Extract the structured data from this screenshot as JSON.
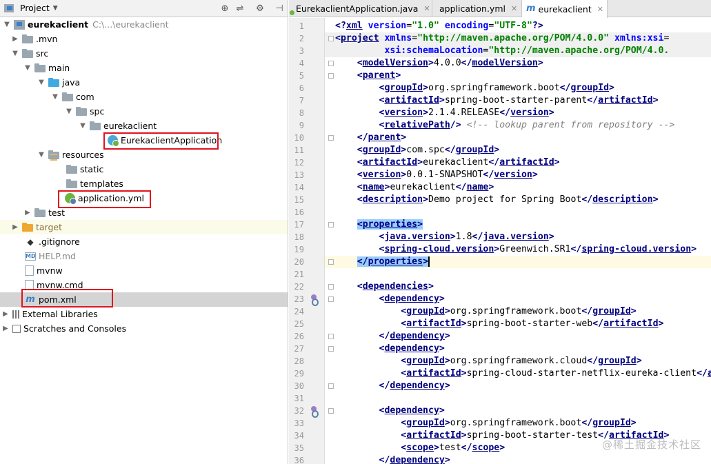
{
  "project_panel": {
    "title": "Project",
    "tools": [
      "⊕",
      "⇌",
      "⚙",
      "⊣"
    ],
    "tree": [
      {
        "label": "eurekaclient",
        "suffix": "C:\\...\\eurekaclient",
        "bold": true
      },
      {
        "label": ".mvn"
      },
      {
        "label": "src"
      },
      {
        "label": "main"
      },
      {
        "label": "java"
      },
      {
        "label": "com"
      },
      {
        "label": "spc"
      },
      {
        "label": "eurekaclient"
      },
      {
        "label": "EurekaclientApplication"
      },
      {
        "label": "resources"
      },
      {
        "label": "static"
      },
      {
        "label": "templates"
      },
      {
        "label": "application.yml"
      },
      {
        "label": "test"
      },
      {
        "label": "target"
      },
      {
        "label": ".gitignore"
      },
      {
        "label": "HELP.md"
      },
      {
        "label": "mvnw"
      },
      {
        "label": "mvnw.cmd"
      },
      {
        "label": "pom.xml"
      },
      {
        "label": "External Libraries"
      },
      {
        "label": "Scratches and Consoles"
      }
    ]
  },
  "editor": {
    "tabs": [
      {
        "label": "EurekaclientApplication.java"
      },
      {
        "label": "application.yml"
      },
      {
        "label": "eurekaclient",
        "active": true
      }
    ],
    "lines": [
      "<?xml version=\"1.0\" encoding=\"UTF-8\"?>",
      "<project xmlns=\"http://maven.apache.org/POM/4.0.0\" xmlns:xsi=",
      "         xsi:schemaLocation=\"http://maven.apache.org/POM/4.0.",
      "    <modelVersion>4.0.0</modelVersion>",
      "    <parent>",
      "        <groupId>org.springframework.boot</groupId>",
      "        <artifactId>spring-boot-starter-parent</artifactId>",
      "        <version>2.1.4.RELEASE</version>",
      "        <relativePath/> <!-- lookup parent from repository -->",
      "    </parent>",
      "    <groupId>com.spc</groupId>",
      "    <artifactId>eurekaclient</artifactId>",
      "    <version>0.0.1-SNAPSHOT</version>",
      "    <name>eurekaclient</name>",
      "    <description>Demo project for Spring Boot</description>",
      "",
      "    <properties>",
      "        <java.version>1.8</java.version>",
      "        <spring-cloud.version>Greenwich.SR1</spring-cloud.version>",
      "    </properties>",
      "",
      "    <dependencies>",
      "        <dependency>",
      "            <groupId>org.springframework.boot</groupId>",
      "            <artifactId>spring-boot-starter-web</artifactId>",
      "        </dependency>",
      "        <dependency>",
      "            <groupId>org.springframework.cloud</groupId>",
      "            <artifactId>spring-cloud-starter-netflix-eureka-client</artifactId>",
      "        </dependency>",
      "",
      "        <dependency>",
      "            <groupId>org.springframework.boot</groupId>",
      "            <artifactId>spring-boot-starter-test</artifactId>",
      "            <scope>test</scope>",
      "        </dependency>"
    ],
    "current_line": 20,
    "watermark": "@稀土掘金技术社区"
  }
}
